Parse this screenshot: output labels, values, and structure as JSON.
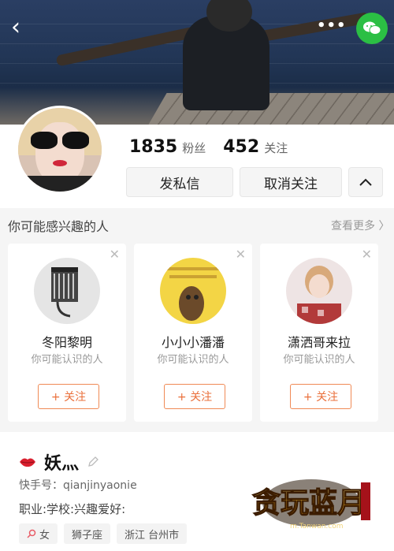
{
  "nav": {
    "back_icon": "back-arrow-icon",
    "more_icon": "more-dots-icon",
    "share_icon": "wechat-icon"
  },
  "profile": {
    "followers": {
      "count": "1835",
      "label": "粉丝"
    },
    "following": {
      "count": "452",
      "label": "关注"
    },
    "message_label": "发私信",
    "unfollow_label": "取消关注",
    "expand_icon": "chevron-up-icon"
  },
  "recommend": {
    "title": "你可能感兴趣的人",
    "more_label": "查看更多 〉",
    "items": [
      {
        "name": "冬阳黎明",
        "subtitle": "你可能认识的人",
        "follow_label": "+ 关注"
      },
      {
        "name": "小小小潘潘",
        "subtitle": "你可能认识的人",
        "follow_label": "+ 关注"
      },
      {
        "name": "潇洒哥来拉",
        "subtitle": "你可能认识的人",
        "follow_label": "+ 关注"
      }
    ]
  },
  "user": {
    "name": "妖灬",
    "kuaishou_id": "快手号：qianjinyaonie",
    "job": "职业:学校:兴趣爱好:",
    "tags": [
      "女",
      "狮子座",
      "浙江 台州市"
    ]
  },
  "watermark": {
    "text": "贪玩蓝月",
    "url": "m.Tanwan.com"
  },
  "colors": {
    "accent": "#ea6f3a",
    "wechat": "#2bbf44"
  }
}
